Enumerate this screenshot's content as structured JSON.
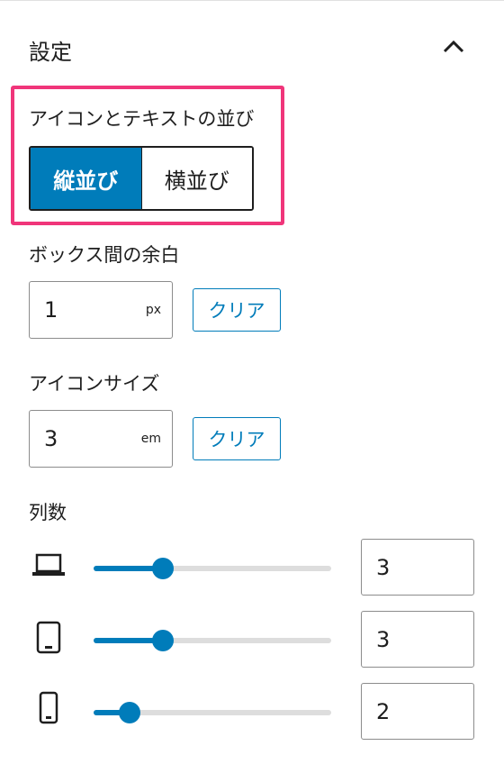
{
  "panel": {
    "title": "設定"
  },
  "icon_text_layout": {
    "label": "アイコンとテキストの並び",
    "options": [
      "縦並び",
      "横並び"
    ],
    "selected": "縦並び"
  },
  "box_spacing": {
    "label": "ボックス間の余白",
    "value": "1",
    "unit": "px",
    "clear_label": "クリア"
  },
  "icon_size": {
    "label": "アイコンサイズ",
    "value": "3",
    "unit": "em",
    "clear_label": "クリア"
  },
  "columns": {
    "label": "列数",
    "rows": [
      {
        "device": "laptop-icon",
        "value": "3",
        "fraction": 0.29
      },
      {
        "device": "tablet-icon",
        "value": "3",
        "fraction": 0.29
      },
      {
        "device": "mobile-icon",
        "value": "2",
        "fraction": 0.15
      }
    ]
  },
  "colors": {
    "accent": "#007cba",
    "highlight": "#f0357a",
    "track": "#dddddd"
  }
}
